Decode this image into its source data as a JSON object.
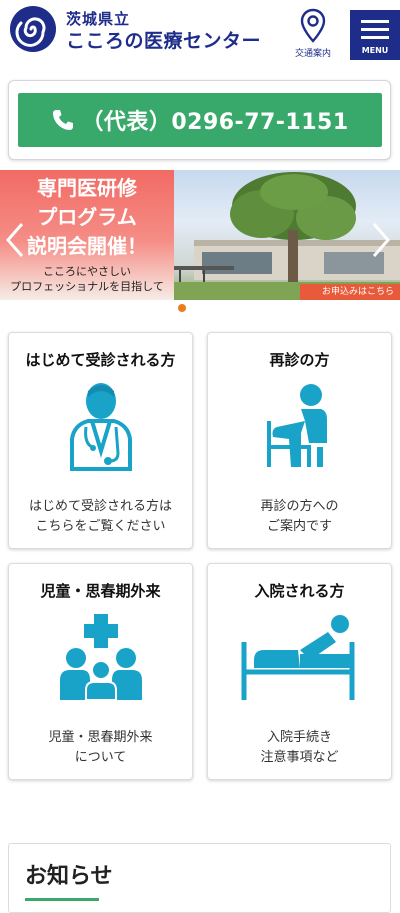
{
  "header": {
    "org_prefix": "茨城県立",
    "org_name": "こころの医療センター",
    "access_label": "交通案内",
    "menu_label": "MENU",
    "brand_color": "#1f2d8a"
  },
  "phone": {
    "text": "（代表）0296-77-1151",
    "color": "#39a96b"
  },
  "banner": {
    "headline": "専門医研修\nプログラム\n説明会開催！",
    "subtitle": "こころにやさしい\nプロフェッショナルを目指して",
    "cta": "お申込みはこちら",
    "slide_active_index": 0
  },
  "cards": [
    {
      "title": "はじめて受診される方",
      "desc": "はじめて受診される方は\nこちらをご覧ください",
      "icon": "doctor-icon"
    },
    {
      "title": "再診の方",
      "desc": "再診の方への\nご案内です",
      "icon": "seated-patient-icon"
    },
    {
      "title": "児童・思春期外来",
      "desc": "児童・思春期外来\nについて",
      "icon": "family-cross-icon"
    },
    {
      "title": "入院される方",
      "desc": "入院手続き\n注意事項など",
      "icon": "hospital-bed-icon"
    }
  ],
  "icon_color": "#1aa3c9",
  "news": {
    "title": "お知らせ"
  }
}
